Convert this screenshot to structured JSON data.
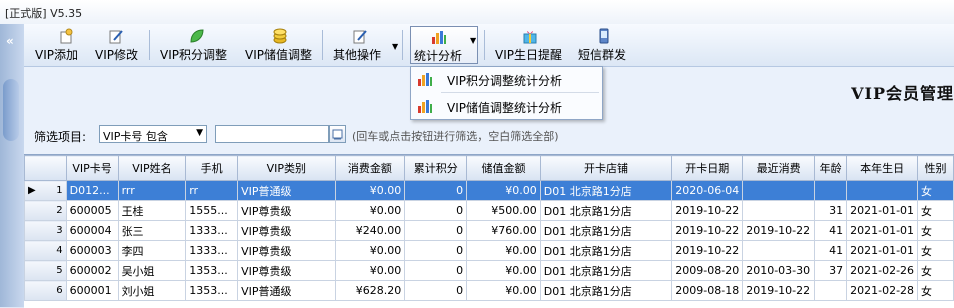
{
  "window": {
    "title": "[正式版] V5.35"
  },
  "toolbar": {
    "buttons": [
      {
        "label": "VIP添加",
        "icon": "add-member-icon"
      },
      {
        "label": "VIP修改",
        "icon": "edit-pencil-icon"
      },
      {
        "label": "VIP积分调整",
        "icon": "leaf-icon"
      },
      {
        "label": "VIP储值调整",
        "icon": "coins-icon"
      },
      {
        "label": "其他操作",
        "icon": "edit-pencil-icon"
      },
      {
        "label": "统计分析",
        "icon": "bar-chart-icon"
      },
      {
        "label": "VIP生日提醒",
        "icon": "gift-box-icon"
      },
      {
        "label": "短信群发",
        "icon": "phone-icon"
      }
    ]
  },
  "dropdown_menu": {
    "items": [
      {
        "label": "VIP积分调整统计分析",
        "icon": "bar-chart-icon"
      },
      {
        "label": "VIP储值调整统计分析",
        "icon": "bar-chart-icon"
      }
    ]
  },
  "page": {
    "title": "VIP会员管理"
  },
  "filter": {
    "label": "筛选项目:",
    "combo_value": "VIP卡号 包含",
    "input_value": "",
    "hint": "(回车或点击按钮进行筛选，空白筛选全部)"
  },
  "table": {
    "columns": [
      "",
      "VIP卡号",
      "VIP姓名",
      "手机",
      "VIP类别",
      "消费金额",
      "累计积分",
      "储值金额",
      "开卡店铺",
      "开卡日期",
      "最近消费",
      "年龄",
      "本年生日",
      "性别"
    ],
    "rows": [
      [
        "1",
        "D012...",
        "rrr",
        "rr",
        "VIP普通级",
        "¥0.00",
        "0",
        "¥0.00",
        "D01 北京路1分店",
        "2020-06-04",
        "",
        "",
        "",
        "女"
      ],
      [
        "2",
        "600005",
        "王桂",
        "1555...",
        "VIP尊贵级",
        "¥0.00",
        "0",
        "¥500.00",
        "D01 北京路1分店",
        "2019-10-22",
        "",
        "31",
        "2021-01-01",
        "女"
      ],
      [
        "3",
        "600004",
        "张三",
        "1333...",
        "VIP尊贵级",
        "¥240.00",
        "0",
        "¥760.00",
        "D01 北京路1分店",
        "2019-10-22",
        "2019-10-22",
        "41",
        "2021-01-01",
        "女"
      ],
      [
        "4",
        "600003",
        "李四",
        "1333...",
        "VIP尊贵级",
        "¥0.00",
        "0",
        "¥0.00",
        "D01 北京路1分店",
        "2019-10-22",
        "",
        "41",
        "2021-01-01",
        "女"
      ],
      [
        "5",
        "600002",
        "吴小姐",
        "1353...",
        "VIP尊贵级",
        "¥0.00",
        "0",
        "¥0.00",
        "D01 北京路1分店",
        "2009-08-20",
        "2010-03-30",
        "37",
        "2021-02-26",
        "女"
      ],
      [
        "6",
        "600001",
        "刘小姐",
        "1353...",
        "VIP普通级",
        "¥628.20",
        "0",
        "¥0.00",
        "D01 北京路1分店",
        "2009-08-18",
        "2019-10-22",
        "",
        "2021-02-28",
        "女"
      ]
    ]
  }
}
